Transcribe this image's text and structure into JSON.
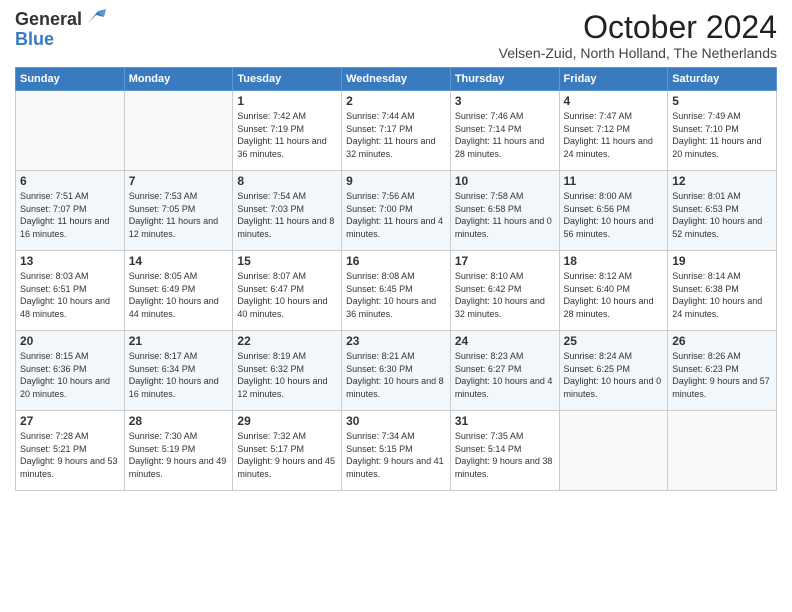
{
  "header": {
    "logo_general": "General",
    "logo_blue": "Blue",
    "month_title": "October 2024",
    "location": "Velsen-Zuid, North Holland, The Netherlands"
  },
  "days_of_week": [
    "Sunday",
    "Monday",
    "Tuesday",
    "Wednesday",
    "Thursday",
    "Friday",
    "Saturday"
  ],
  "weeks": [
    [
      {
        "day": "",
        "info": ""
      },
      {
        "day": "",
        "info": ""
      },
      {
        "day": "1",
        "info": "Sunrise: 7:42 AM\nSunset: 7:19 PM\nDaylight: 11 hours and 36 minutes."
      },
      {
        "day": "2",
        "info": "Sunrise: 7:44 AM\nSunset: 7:17 PM\nDaylight: 11 hours and 32 minutes."
      },
      {
        "day": "3",
        "info": "Sunrise: 7:46 AM\nSunset: 7:14 PM\nDaylight: 11 hours and 28 minutes."
      },
      {
        "day": "4",
        "info": "Sunrise: 7:47 AM\nSunset: 7:12 PM\nDaylight: 11 hours and 24 minutes."
      },
      {
        "day": "5",
        "info": "Sunrise: 7:49 AM\nSunset: 7:10 PM\nDaylight: 11 hours and 20 minutes."
      }
    ],
    [
      {
        "day": "6",
        "info": "Sunrise: 7:51 AM\nSunset: 7:07 PM\nDaylight: 11 hours and 16 minutes."
      },
      {
        "day": "7",
        "info": "Sunrise: 7:53 AM\nSunset: 7:05 PM\nDaylight: 11 hours and 12 minutes."
      },
      {
        "day": "8",
        "info": "Sunrise: 7:54 AM\nSunset: 7:03 PM\nDaylight: 11 hours and 8 minutes."
      },
      {
        "day": "9",
        "info": "Sunrise: 7:56 AM\nSunset: 7:00 PM\nDaylight: 11 hours and 4 minutes."
      },
      {
        "day": "10",
        "info": "Sunrise: 7:58 AM\nSunset: 6:58 PM\nDaylight: 11 hours and 0 minutes."
      },
      {
        "day": "11",
        "info": "Sunrise: 8:00 AM\nSunset: 6:56 PM\nDaylight: 10 hours and 56 minutes."
      },
      {
        "day": "12",
        "info": "Sunrise: 8:01 AM\nSunset: 6:53 PM\nDaylight: 10 hours and 52 minutes."
      }
    ],
    [
      {
        "day": "13",
        "info": "Sunrise: 8:03 AM\nSunset: 6:51 PM\nDaylight: 10 hours and 48 minutes."
      },
      {
        "day": "14",
        "info": "Sunrise: 8:05 AM\nSunset: 6:49 PM\nDaylight: 10 hours and 44 minutes."
      },
      {
        "day": "15",
        "info": "Sunrise: 8:07 AM\nSunset: 6:47 PM\nDaylight: 10 hours and 40 minutes."
      },
      {
        "day": "16",
        "info": "Sunrise: 8:08 AM\nSunset: 6:45 PM\nDaylight: 10 hours and 36 minutes."
      },
      {
        "day": "17",
        "info": "Sunrise: 8:10 AM\nSunset: 6:42 PM\nDaylight: 10 hours and 32 minutes."
      },
      {
        "day": "18",
        "info": "Sunrise: 8:12 AM\nSunset: 6:40 PM\nDaylight: 10 hours and 28 minutes."
      },
      {
        "day": "19",
        "info": "Sunrise: 8:14 AM\nSunset: 6:38 PM\nDaylight: 10 hours and 24 minutes."
      }
    ],
    [
      {
        "day": "20",
        "info": "Sunrise: 8:15 AM\nSunset: 6:36 PM\nDaylight: 10 hours and 20 minutes."
      },
      {
        "day": "21",
        "info": "Sunrise: 8:17 AM\nSunset: 6:34 PM\nDaylight: 10 hours and 16 minutes."
      },
      {
        "day": "22",
        "info": "Sunrise: 8:19 AM\nSunset: 6:32 PM\nDaylight: 10 hours and 12 minutes."
      },
      {
        "day": "23",
        "info": "Sunrise: 8:21 AM\nSunset: 6:30 PM\nDaylight: 10 hours and 8 minutes."
      },
      {
        "day": "24",
        "info": "Sunrise: 8:23 AM\nSunset: 6:27 PM\nDaylight: 10 hours and 4 minutes."
      },
      {
        "day": "25",
        "info": "Sunrise: 8:24 AM\nSunset: 6:25 PM\nDaylight: 10 hours and 0 minutes."
      },
      {
        "day": "26",
        "info": "Sunrise: 8:26 AM\nSunset: 6:23 PM\nDaylight: 9 hours and 57 minutes."
      }
    ],
    [
      {
        "day": "27",
        "info": "Sunrise: 7:28 AM\nSunset: 5:21 PM\nDaylight: 9 hours and 53 minutes."
      },
      {
        "day": "28",
        "info": "Sunrise: 7:30 AM\nSunset: 5:19 PM\nDaylight: 9 hours and 49 minutes."
      },
      {
        "day": "29",
        "info": "Sunrise: 7:32 AM\nSunset: 5:17 PM\nDaylight: 9 hours and 45 minutes."
      },
      {
        "day": "30",
        "info": "Sunrise: 7:34 AM\nSunset: 5:15 PM\nDaylight: 9 hours and 41 minutes."
      },
      {
        "day": "31",
        "info": "Sunrise: 7:35 AM\nSunset: 5:14 PM\nDaylight: 9 hours and 38 minutes."
      },
      {
        "day": "",
        "info": ""
      },
      {
        "day": "",
        "info": ""
      }
    ]
  ]
}
